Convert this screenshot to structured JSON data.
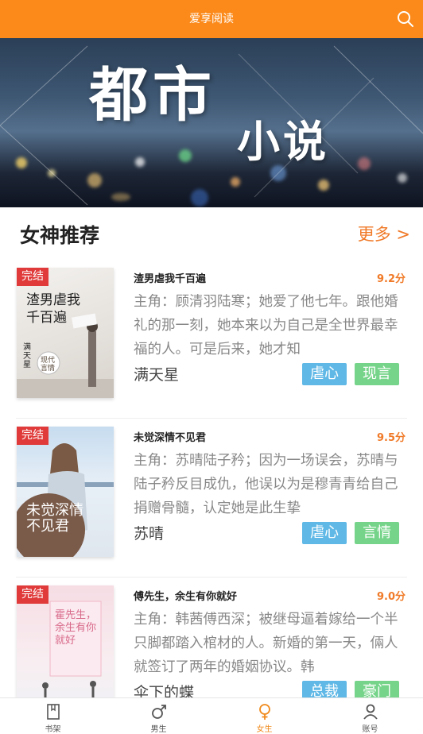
{
  "header": {
    "title": "爱享阅读",
    "search_icon": "search-icon"
  },
  "banner": {
    "line1": "都市",
    "line2": "小说"
  },
  "section": {
    "title": "女神推荐",
    "more": "更多 >"
  },
  "books": [
    {
      "badge": "完结",
      "cover_title": "渣男虐我千百遍",
      "cover_author": "满天星",
      "cover_tag": "现代言情",
      "name": "渣男虐我千百遍",
      "score": "9.2分",
      "desc": "主角：顾清羽陆寒；她爱了他七年。跟他婚礼的那一刻，她本来以为自己是全世界最幸福的人。可是后来，她才知",
      "author": "满天星",
      "tags": [
        "虐心",
        "现言"
      ]
    },
    {
      "badge": "完结",
      "cover_title": "未觉深情不见君",
      "name": "未觉深情不见君",
      "score": "9.5分",
      "desc": "主角：苏晴陆子矜；因为一场误会，苏晴与陆子矜反目成仇，他误以为是穆青青给自己捐赠骨髓，认定她是此生挚",
      "author": "苏晴",
      "tags": [
        "虐心",
        "言情"
      ]
    },
    {
      "badge": "完结",
      "cover_title": "霍先生，余生有你就好",
      "name": "傅先生，余生有你就好",
      "score": "9.0分",
      "desc": "主角：韩茜傅西深；被继母逼着嫁给一个半只脚都踏入棺材的人。新婚的第一天，倆人就签订了两年的婚姻协议。韩",
      "author": "伞下的蝶",
      "tags": [
        "总裁",
        "豪门"
      ]
    }
  ],
  "tabbar": [
    {
      "label": "书架",
      "icon": "bookshelf-icon"
    },
    {
      "label": "男生",
      "icon": "male-icon"
    },
    {
      "label": "女生",
      "icon": "female-icon",
      "active": true
    },
    {
      "label": "账号",
      "icon": "account-icon"
    }
  ],
  "colors": {
    "accent": "#fb8a1a",
    "badge": "#e03a3a",
    "tag_blue": "#5fb8e6",
    "tag_green": "#76d48a"
  }
}
